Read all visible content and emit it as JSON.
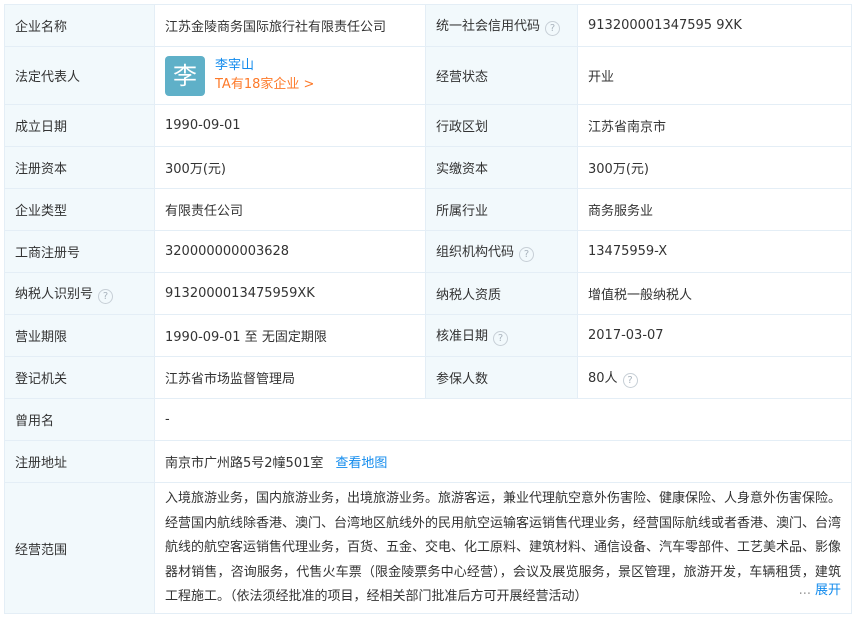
{
  "rows": {
    "company_name": {
      "label": "企业名称",
      "value": "江苏金陵商务国际旅行社有限责任公司"
    },
    "credit_code": {
      "label": "统一社会信用代码",
      "value": "913200001347595 9XK"
    },
    "legal_rep": {
      "label": "法定代表人",
      "avatar_char": "李",
      "name": "李宰山",
      "sub": "TA有18家企业 >"
    },
    "status": {
      "label": "经营状态",
      "value": "开业"
    },
    "established": {
      "label": "成立日期",
      "value": "1990-09-01"
    },
    "region": {
      "label": "行政区划",
      "value": "江苏省南京市"
    },
    "reg_capital": {
      "label": "注册资本",
      "value": "300万(元)"
    },
    "paid_capital": {
      "label": "实缴资本",
      "value": "300万(元)"
    },
    "company_type": {
      "label": "企业类型",
      "value": "有限责任公司"
    },
    "industry": {
      "label": "所属行业",
      "value": "商务服务业"
    },
    "reg_no": {
      "label": "工商注册号",
      "value": "320000000003628"
    },
    "org_code": {
      "label": "组织机构代码",
      "value": "13475959-X"
    },
    "taxpayer_id": {
      "label": "纳税人识别号",
      "value": "9132000013475959XK"
    },
    "taxpayer_qual": {
      "label": "纳税人资质",
      "value": "增值税一般纳税人"
    },
    "term": {
      "label": "营业期限",
      "value": "1990-09-01 至 无固定期限"
    },
    "approve_date": {
      "label": "核准日期",
      "value": "2017-03-07"
    },
    "authority": {
      "label": "登记机关",
      "value": "江苏省市场监督管理局"
    },
    "insured": {
      "label": "参保人数",
      "value": "80人"
    },
    "former_name": {
      "label": "曾用名",
      "value": "-"
    },
    "address": {
      "label": "注册地址",
      "value": "南京市广州路5号2幢501室",
      "link": "查看地图"
    },
    "scope": {
      "label": "经营范围",
      "value": "入境旅游业务，国内旅游业务，出境旅游业务。旅游客运，兼业代理航空意外伤害险、健康保险、人身意外伤害保险。经营国内航线除香港、澳门、台湾地区航线外的民用航空运输客运销售代理业务，经营国际航线或者香港、澳门、台湾航线的航空客运销售代理业务，百货、五金、交电、化工原料、建筑材料、通信设备、汽车零部件、工艺美术品、影像器材销售，咨询服务，代售火车票（限金陵票务中心经营），会议及展览服务，景区管理，旅游开发，车辆租赁，建筑工程施工。（依法须经批准的项目，经相关部门批准后方可开展经营活动）",
      "dots": "...",
      "expand": "展开"
    }
  },
  "help_icon": "?",
  "colors": {
    "label_bg": "#f2f9fc",
    "border": "#e4eef6",
    "link": "#128bed",
    "orange": "#fd7a2a",
    "avatar_bg": "#5fb0c8"
  }
}
